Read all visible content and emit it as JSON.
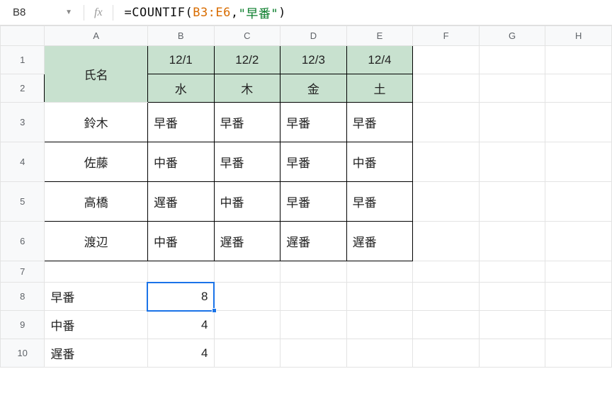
{
  "namebox": {
    "ref": "B8"
  },
  "formula": {
    "raw": "=COUNTIF(B3:E6,\"早番\")",
    "tokens": {
      "eq": "=",
      "fn": "COUNTIF",
      "lp": "(",
      "range": "B3:E6",
      "comma": ",",
      "str": "\"早番\"",
      "rp": ")"
    }
  },
  "columns": [
    "A",
    "B",
    "C",
    "D",
    "E",
    "F",
    "G",
    "H"
  ],
  "rows": [
    "1",
    "2",
    "3",
    "4",
    "5",
    "6",
    "7",
    "8",
    "9",
    "10"
  ],
  "header": {
    "name_label": "氏名",
    "dates": [
      "12/1",
      "12/2",
      "12/3",
      "12/4"
    ],
    "weekdays": [
      "水",
      "木",
      "金",
      "土"
    ]
  },
  "people": [
    {
      "name": "鈴木",
      "shifts": [
        "早番",
        "早番",
        "早番",
        "早番"
      ]
    },
    {
      "name": "佐藤",
      "shifts": [
        "中番",
        "早番",
        "早番",
        "中番"
      ]
    },
    {
      "name": "高橋",
      "shifts": [
        "遅番",
        "中番",
        "早番",
        "早番"
      ]
    },
    {
      "name": "渡辺",
      "shifts": [
        "中番",
        "遅番",
        "遅番",
        "遅番"
      ]
    }
  ],
  "summary": [
    {
      "label": "早番",
      "count": "8"
    },
    {
      "label": "中番",
      "count": "4"
    },
    {
      "label": "遅番",
      "count": "4"
    }
  ],
  "chart_data": {
    "type": "table",
    "title": "Shift schedule and COUNTIF summary",
    "columns": [
      "氏名",
      "12/1 水",
      "12/2 木",
      "12/3 金",
      "12/4 土"
    ],
    "rows": [
      [
        "鈴木",
        "早番",
        "早番",
        "早番",
        "早番"
      ],
      [
        "佐藤",
        "中番",
        "早番",
        "早番",
        "中番"
      ],
      [
        "高橋",
        "遅番",
        "中番",
        "早番",
        "早番"
      ],
      [
        "渡辺",
        "中番",
        "遅番",
        "遅番",
        "遅番"
      ]
    ],
    "summary": {
      "早番": 8,
      "中番": 4,
      "遅番": 4
    },
    "formula": "=COUNTIF(B3:E6,\"早番\")",
    "selected_cell": "B8"
  },
  "colors": {
    "header_fill": "#c8e1cf",
    "selection": "#1a73e8",
    "range_token": "#d86c00",
    "string_token": "#0a7d2b"
  }
}
